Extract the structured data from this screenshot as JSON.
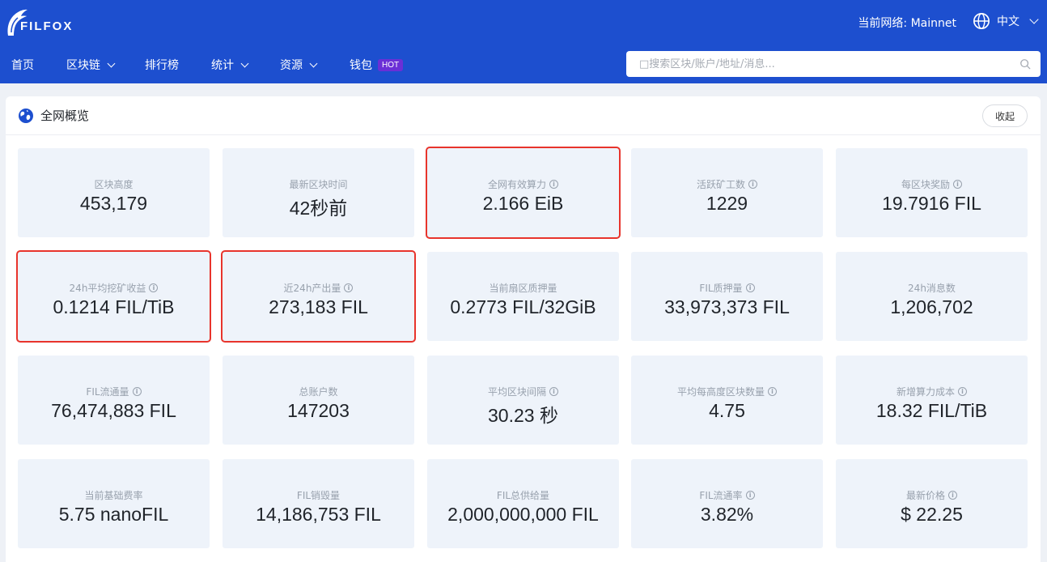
{
  "header": {
    "logo_text": "FILFOX",
    "network_label": "当前网络: Mainnet",
    "language": "中文",
    "nav": [
      {
        "label": "首页",
        "has_dropdown": false
      },
      {
        "label": "区块链",
        "has_dropdown": true
      },
      {
        "label": "排行榜",
        "has_dropdown": false
      },
      {
        "label": "统计",
        "has_dropdown": true
      },
      {
        "label": "资源",
        "has_dropdown": true
      },
      {
        "label": "钱包",
        "has_dropdown": false,
        "badge": "HOT"
      }
    ],
    "search_placeholder": "□搜索区块/账户/地址/消息..."
  },
  "overview": {
    "title": "全网概览",
    "collapse_label": "收起",
    "cards": [
      {
        "label": "区块高度",
        "value": "453,179",
        "info": false,
        "highlighted": false
      },
      {
        "label": "最新区块时间",
        "value": "42秒前",
        "info": false,
        "highlighted": false
      },
      {
        "label": "全网有效算力",
        "value": "2.166 EiB",
        "info": true,
        "highlighted": true
      },
      {
        "label": "活跃矿工数",
        "value": "1229",
        "info": true,
        "highlighted": false
      },
      {
        "label": "每区块奖励",
        "value": "19.7916 FIL",
        "info": true,
        "highlighted": false
      },
      {
        "label": "24h平均挖矿收益",
        "value": "0.1214 FIL/TiB",
        "info": true,
        "highlighted": true
      },
      {
        "label": "近24h产出量",
        "value": "273,183 FIL",
        "info": true,
        "highlighted": true
      },
      {
        "label": "当前扇区质押量",
        "value": "0.2773 FIL/32GiB",
        "info": false,
        "highlighted": false
      },
      {
        "label": "FIL质押量",
        "value": "33,973,373 FIL",
        "info": true,
        "highlighted": false
      },
      {
        "label": "24h消息数",
        "value": "1,206,702",
        "info": false,
        "highlighted": false
      },
      {
        "label": "FIL流通量",
        "value": "76,474,883 FIL",
        "info": true,
        "highlighted": false
      },
      {
        "label": "总账户数",
        "value": "147203",
        "info": false,
        "highlighted": false
      },
      {
        "label": "平均区块间隔",
        "value": "30.23 秒",
        "info": true,
        "highlighted": false
      },
      {
        "label": "平均每高度区块数量",
        "value": "4.75",
        "info": true,
        "highlighted": false
      },
      {
        "label": "新增算力成本",
        "value": "18.32 FIL/TiB",
        "info": true,
        "highlighted": false
      },
      {
        "label": "当前基础费率",
        "value": "5.75 nanoFIL",
        "info": false,
        "highlighted": false
      },
      {
        "label": "FIL销毁量",
        "value": "14,186,753 FIL",
        "info": false,
        "highlighted": false
      },
      {
        "label": "FIL总供给量",
        "value": "2,000,000,000 FIL",
        "info": false,
        "highlighted": false
      },
      {
        "label": "FIL流通率",
        "value": "3.82%",
        "info": true,
        "highlighted": false
      },
      {
        "label": "最新价格",
        "value": "$ 22.25",
        "info": true,
        "highlighted": false
      }
    ]
  },
  "colors": {
    "header_bg": "#1d4fcf",
    "card_bg": "#eef3fa",
    "highlight": "#e8342c",
    "hot_badge": "#6b2fd6"
  }
}
